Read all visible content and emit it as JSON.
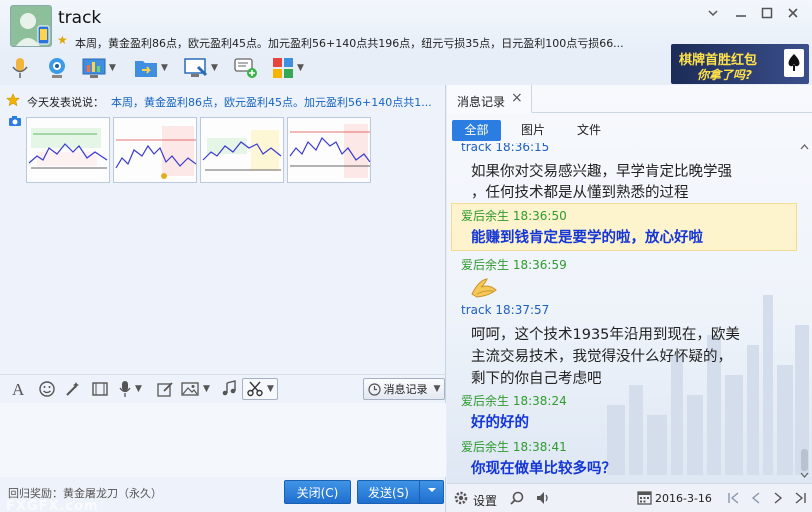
{
  "header": {
    "title": "track",
    "signature": "本周，黄金盈利86点，欧元盈利45点。加元盈利56+140点共196点，纽元亏损35点，日元盈利100点亏损66...",
    "window_buttons": [
      "settings",
      "minimize",
      "maximize",
      "close"
    ]
  },
  "ad": {
    "line1": "棋牌首胜红包",
    "line2": "你拿了吗?"
  },
  "feed": {
    "label": "今天发表说说：",
    "text": "本周，黄金盈利86点，欧元盈利45点。加元盈利56+140点共1..."
  },
  "thumbnails": [
    "chart-1",
    "chart-2",
    "chart-3",
    "chart-4"
  ],
  "input_toolbar": {
    "record_label": "消息记录"
  },
  "footer": {
    "reward": "回归奖励：黄金屠龙刀（永久）",
    "close_label": "关闭(C)",
    "send_label": "发送(S)",
    "watermark": "FXGFX.com"
  },
  "history": {
    "tab_label": "消息记录",
    "filters": [
      "全部",
      "图片",
      "文件"
    ],
    "messages": [
      {
        "sender": "track",
        "time": "18:36:15",
        "lines": [
          "如果你对交易感兴趣，早学肯定比晚学强",
          "，任何技术都是从懂到熟悉的过程"
        ]
      },
      {
        "sender": "爱后余生",
        "time": "18:36:50",
        "lines": [
          "能赚到钱肯定是要学的啦，放心好啦"
        ]
      },
      {
        "sender": "爱后余生",
        "time": "18:36:59",
        "lines": []
      },
      {
        "sender": "track",
        "time": "18:37:57",
        "lines": [
          "呵呵，这个技术1935年沿用到现在，欧美",
          "主流交易技术，我觉得没什么好怀疑的，",
          "剩下的你自己考虑吧"
        ]
      },
      {
        "sender": "爱后余生",
        "time": "18:38:24",
        "lines": [
          "好的好的"
        ]
      },
      {
        "sender": "爱后余生",
        "time": "18:38:41",
        "lines": [
          "你现在做单比较多吗？"
        ]
      }
    ],
    "settings_label": "设置",
    "date": "2016-3-16"
  },
  "colors": {
    "accent": "#2b7de1",
    "self_name": "#2f9a2f",
    "other_name": "#1f5fc0",
    "self_text": "#1536d6"
  }
}
